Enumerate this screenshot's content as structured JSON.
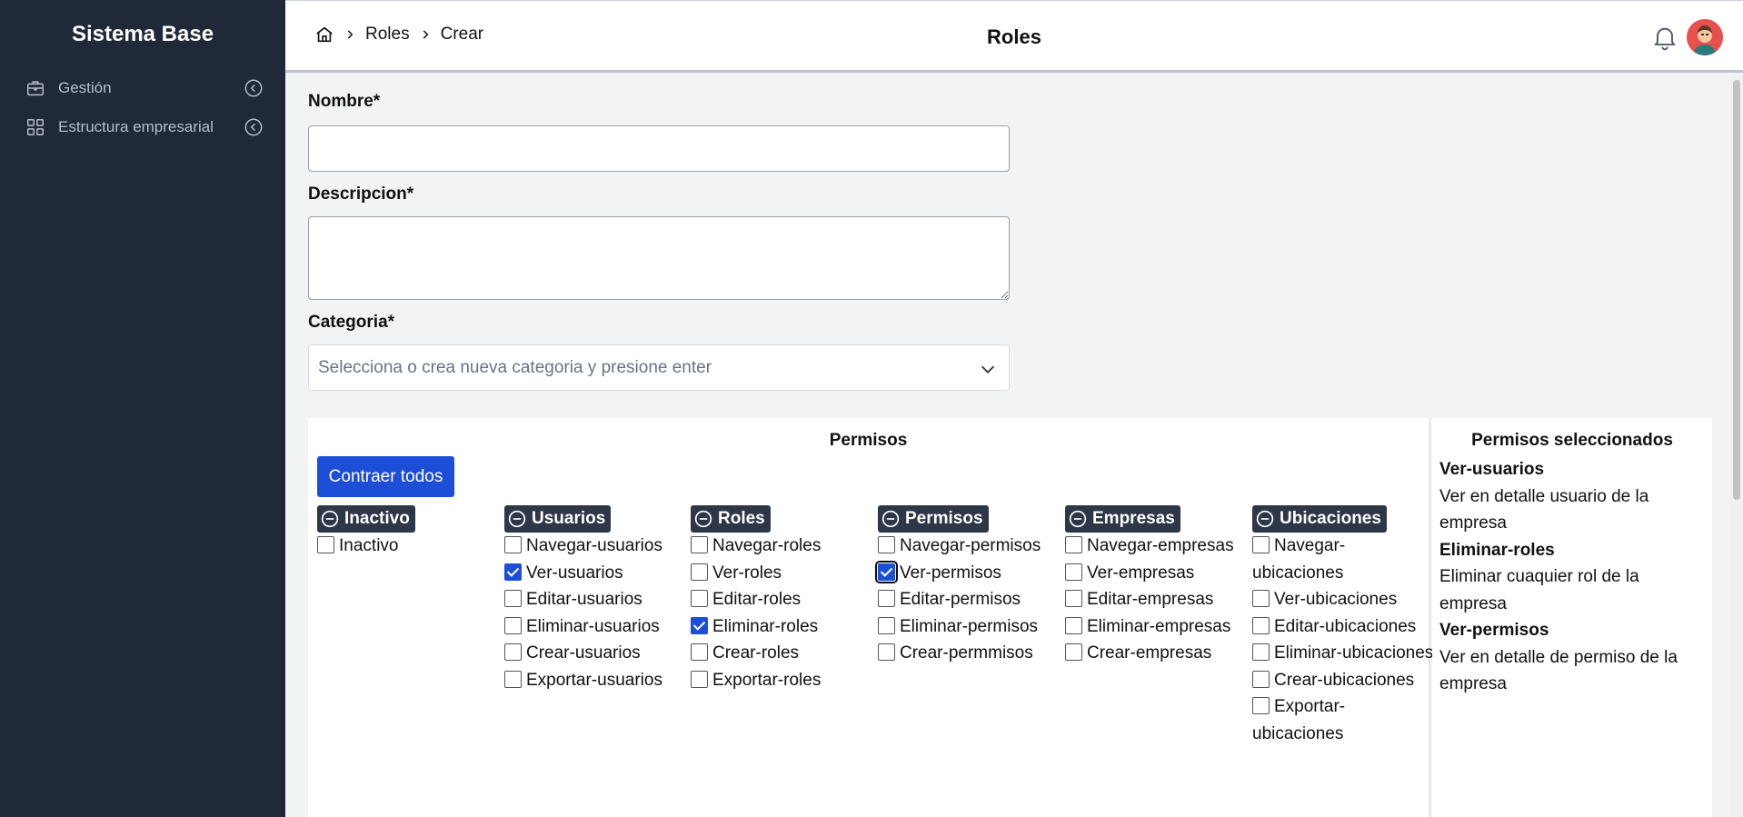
{
  "app": {
    "brand": "Sistema Base"
  },
  "sidebar": {
    "items": [
      {
        "label": "Gestión",
        "icon": "briefcase-icon"
      },
      {
        "label": "Estructura empresarial",
        "icon": "grid-icon"
      }
    ]
  },
  "header": {
    "breadcrumb": [
      "Roles",
      "Crear"
    ],
    "title": "Roles"
  },
  "form": {
    "nombre_label": "Nombre*",
    "nombre_value": "",
    "descripcion_label": "Descripcion*",
    "descripcion_value": "",
    "categoria_label": "Categoria*",
    "categoria_placeholder": "Selecciona o crea nueva categoria y presione enter"
  },
  "permisos": {
    "title": "Permisos",
    "collapse_button": "Contraer todos",
    "groups": [
      {
        "name": "Inactivo",
        "items": [
          {
            "label": "Inactivo",
            "checked": false
          }
        ]
      },
      {
        "name": "Usuarios",
        "items": [
          {
            "label": "Navegar-usuarios",
            "checked": false
          },
          {
            "label": "Ver-usuarios",
            "checked": true
          },
          {
            "label": "Editar-usuarios",
            "checked": false
          },
          {
            "label": "Eliminar-usuarios",
            "checked": false
          },
          {
            "label": "Crear-usuarios",
            "checked": false
          },
          {
            "label": "Exportar-usuarios",
            "checked": false
          }
        ]
      },
      {
        "name": "Roles",
        "items": [
          {
            "label": "Navegar-roles",
            "checked": false
          },
          {
            "label": "Ver-roles",
            "checked": false
          },
          {
            "label": "Editar-roles",
            "checked": false
          },
          {
            "label": "Eliminar-roles",
            "checked": true
          },
          {
            "label": "Crear-roles",
            "checked": false
          },
          {
            "label": "Exportar-roles",
            "checked": false
          }
        ]
      },
      {
        "name": "Permisos",
        "items": [
          {
            "label": "Navegar-permisos",
            "checked": false
          },
          {
            "label": "Ver-permisos",
            "checked": true
          },
          {
            "label": "Editar-permisos",
            "checked": false
          },
          {
            "label": "Eliminar-permisos",
            "checked": false
          },
          {
            "label": "Crear-permmisos",
            "checked": false
          }
        ]
      },
      {
        "name": "Empresas",
        "items": [
          {
            "label": "Navegar-empresas",
            "checked": false
          },
          {
            "label": "Ver-empresas",
            "checked": false
          },
          {
            "label": "Editar-empresas",
            "checked": false
          },
          {
            "label": "Eliminar-empresas",
            "checked": false
          },
          {
            "label": "Crear-empresas",
            "checked": false
          }
        ]
      },
      {
        "name": "Ubicaciones",
        "items": [
          {
            "label": "Navegar-ubicaciones",
            "checked": false
          },
          {
            "label": "Ver-ubicaciones",
            "checked": false
          },
          {
            "label": "Editar-ubicaciones",
            "checked": false
          },
          {
            "label": "Eliminar-ubicaciones",
            "checked": false
          },
          {
            "label": "Crear-ubicaciones",
            "checked": false
          },
          {
            "label": "Exportar-ubicaciones",
            "checked": false
          }
        ]
      }
    ]
  },
  "seleccionados": {
    "title": "Permisos seleccionados",
    "items": [
      {
        "name": "Ver-usuarios",
        "description": "Ver en detalle usuario de la empresa"
      },
      {
        "name": "Eliminar-roles",
        "description": "Eliminar cuaquier rol de la empresa"
      },
      {
        "name": "Ver-permisos",
        "description": "Ver en detalle de permiso de la empresa"
      }
    ]
  },
  "colors": {
    "sidebar": "#1f2937",
    "accent": "#1d4ed8",
    "group_header": "#2d3748"
  }
}
